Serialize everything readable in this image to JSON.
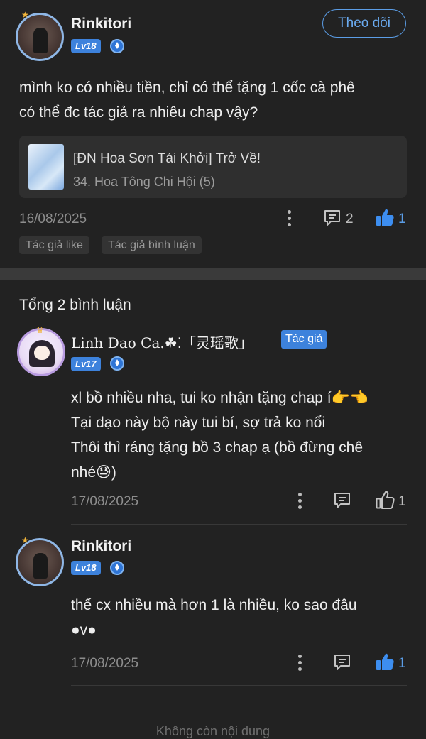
{
  "post": {
    "username": "Rinkitori",
    "level": "Lv18",
    "follow_label": "Theo dõi",
    "content": "mình ko có nhiều tiền, chỉ có thể tặng 1 cốc cà phê\ncó thể đc tác giả ra nhiêu chap vậy?",
    "card": {
      "title": "[ĐN Hoa Sơn Tái Khởi] Trở Về!",
      "subtitle": "34. Hoa Tông Chi Hội (5)"
    },
    "date": "16/08/2025",
    "comment_count": "2",
    "like_count": "1",
    "tags": [
      "Tác giả like",
      "Tác giả bình luận"
    ]
  },
  "comments_header": "Tổng 2 bình luận",
  "comments": [
    {
      "username": "Linh Dao Ca.☘⁚「灵瑶歌」",
      "badge": "Tác giả",
      "level": "Lv17",
      "content": "xl bồ nhiều nha, tui ko nhận tặng chap í👉👈\nTại dạo này bộ này tui bí, sợ trả ko nổi\nThôi thì ráng tặng bồ 3 chap ạ (bồ đừng chê\nnhé😓)",
      "date": "17/08/2025",
      "like_count": "1",
      "liked": false
    },
    {
      "username": "Rinkitori",
      "level": "Lv18",
      "content": "thế cx nhiều mà hơn 1 là nhiều, ko sao đâu\n●v●",
      "date": "17/08/2025",
      "like_count": "1",
      "liked": true
    }
  ],
  "footer": "Không còn nội dung",
  "colors": {
    "accent": "#3d82dc",
    "background": "#222222",
    "like_active": "#3d8ef0"
  }
}
